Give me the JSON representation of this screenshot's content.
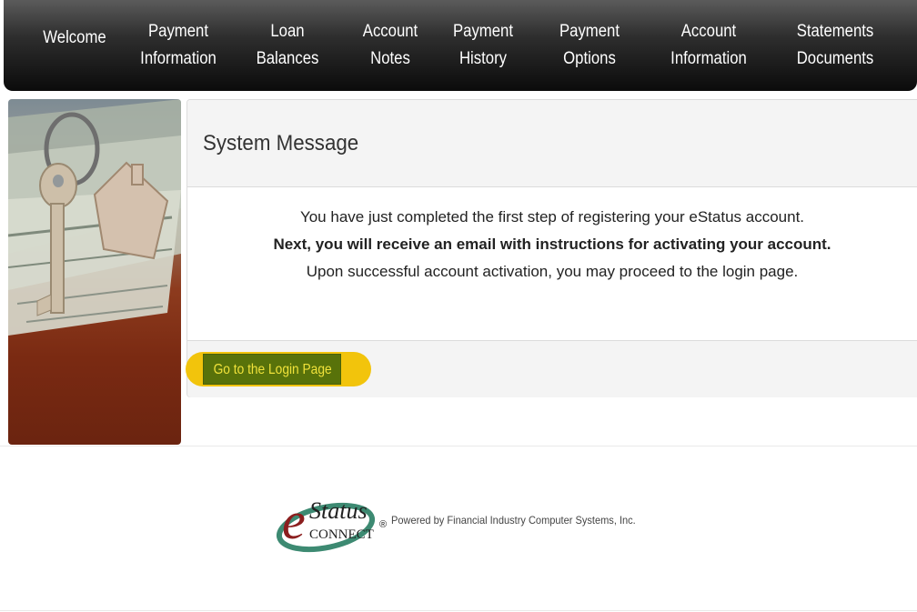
{
  "nav": {
    "items": [
      {
        "line1": "Welcome",
        "line2": ""
      },
      {
        "line1": "Payment",
        "line2": "Information"
      },
      {
        "line1": "Loan",
        "line2": "Balances"
      },
      {
        "line1": "Account",
        "line2": "Notes"
      },
      {
        "line1": "Payment",
        "line2": "History"
      },
      {
        "line1": "Payment",
        "line2": "Options"
      },
      {
        "line1": "Account",
        "line2": "Information"
      },
      {
        "line1": "Statements",
        "line2": "Documents"
      }
    ]
  },
  "panel": {
    "title": "System Message",
    "message_line1": "You have just completed the first step of registering your eStatus account.",
    "message_line2": "Next, you will receive an email with instructions for activating your account.",
    "message_line3": "Upon successful account activation, you may proceed to the login page.",
    "login_button": "Go to the Login Page"
  },
  "footer": {
    "logo_text_top": "Status",
    "logo_text_e": "e",
    "logo_text_bottom": "CONNECT",
    "registered": "®",
    "powered_by": "Powered by Financial Industry Computer Systems, Inc."
  },
  "colors": {
    "nav_bg": "#1a1a1a",
    "login_button_bg": "#58720a",
    "login_button_text": "#f0e23a",
    "highlight": "#f2c40c"
  }
}
